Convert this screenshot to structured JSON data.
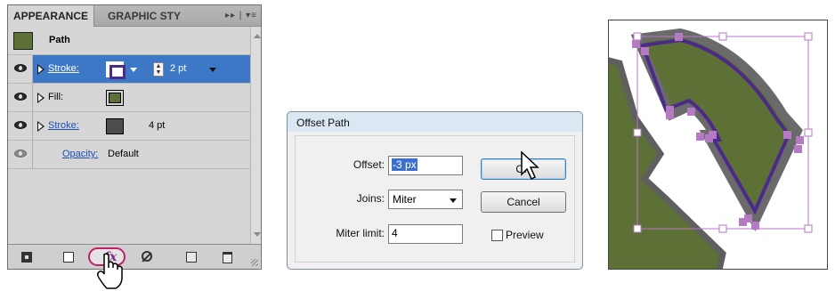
{
  "appearance_panel": {
    "tabs": {
      "active": "APPEARANCE",
      "inactive": "GRAPHIC STY",
      "menu_glyph": "▸▸ | ▾≡"
    },
    "header": {
      "title": "Path"
    },
    "rows": [
      {
        "label": "Stroke:",
        "value": "2 pt",
        "swatch_color": "#4b2a8a",
        "selected": true
      },
      {
        "label": "Fill:",
        "swatch_color": "#5d7035"
      },
      {
        "label": "Stroke:",
        "value": "4 pt",
        "swatch_color": "#4c4c4c"
      },
      {
        "label": "Opacity:",
        "value": "Default"
      }
    ],
    "bottom_bar": {
      "fx_label": "fx"
    }
  },
  "offset_dialog": {
    "title": "Offset Path",
    "offset_label": "Offset:",
    "offset_value": "-3 px",
    "joins_label": "Joins:",
    "joins_value": "Miter",
    "miter_label": "Miter limit:",
    "miter_value": "4",
    "ok_label": "OK",
    "cancel_label": "Cancel",
    "preview_label": "Preview"
  },
  "colors": {
    "selection_blue": "#3d78c7",
    "fill_green": "#5d7035",
    "stroke_purple": "#4b2a8a",
    "stroke_gray": "#4c4c4c",
    "anchor_purple": "#b57ac4",
    "highlight_magenta": "#c21f6b"
  }
}
